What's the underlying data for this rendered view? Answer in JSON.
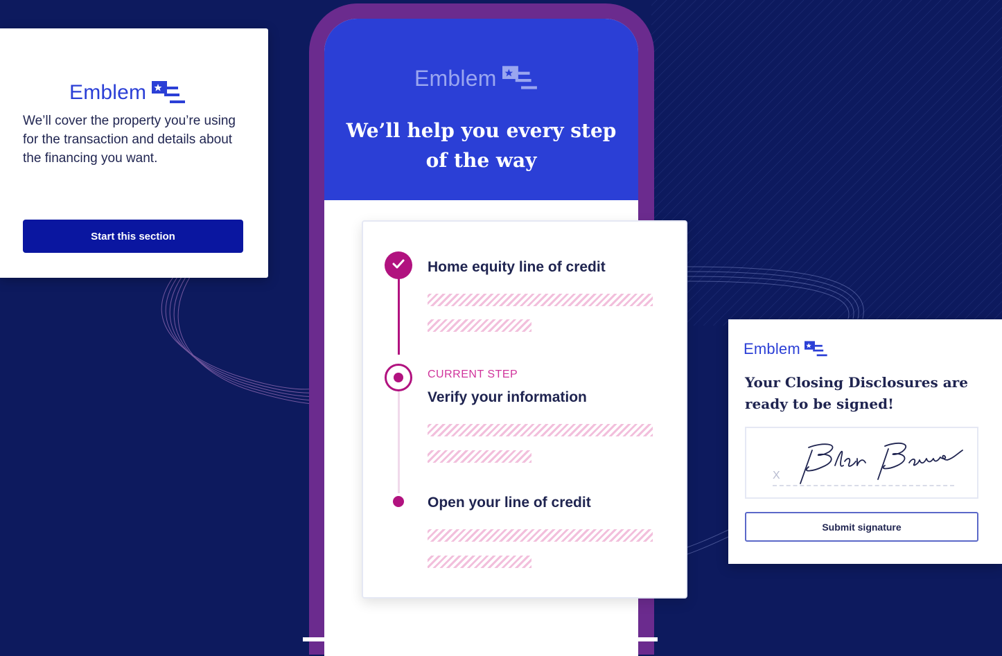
{
  "colors": {
    "background": "#0d1a5e",
    "brand_blue": "#2b3fd6",
    "button_navy": "#0a16a0",
    "accent_magenta": "#b1127f",
    "phone_frame": "#6b2b8e"
  },
  "brand": {
    "name": "Emblem",
    "icon": "flag-icon"
  },
  "left_card": {
    "description": "We’ll cover the property you’re using for the transaction and details about the financing you want.",
    "button_label": "Start this section"
  },
  "phone": {
    "title": "We’ll help you every step of the way"
  },
  "steps": {
    "items": [
      {
        "label": "Home equity line of credit",
        "status": "completed"
      },
      {
        "tag": "CURRENT STEP",
        "label": "Verify your information",
        "status": "current"
      },
      {
        "label": "Open your line of credit",
        "status": "upcoming"
      }
    ]
  },
  "right_card": {
    "headline": "Your Closing Disclosures are ready to be signed!",
    "signature_x": "X",
    "signature_name": "Blair Borrower",
    "button_label": "Submit signature"
  }
}
